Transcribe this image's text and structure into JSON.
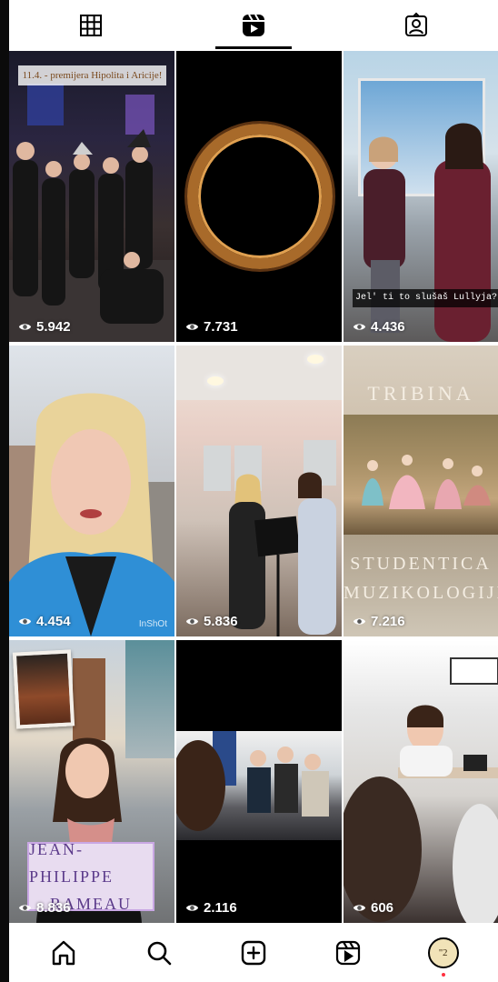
{
  "tabs": [
    {
      "id": "grid",
      "icon": "grid-icon",
      "active": false
    },
    {
      "id": "reels",
      "icon": "reels-icon",
      "active": true
    },
    {
      "id": "tagged",
      "icon": "tagged-icon",
      "active": false
    }
  ],
  "reels": [
    {
      "views": "5.942",
      "caption": "11.4. - premijera Hipolita i Aricije!"
    },
    {
      "views": "7.731"
    },
    {
      "views": "4.436",
      "caption": "Jel' ti to slušaš Lullyja?"
    },
    {
      "views": "4.454",
      "watermark": "InShOt"
    },
    {
      "views": "5.836"
    },
    {
      "views": "7.216",
      "title_top": "TRIBINA",
      "title_bottom_1": "STUDENTICA",
      "title_bottom_2": "MUZIKOLOGIJE"
    },
    {
      "views": "8.836",
      "card_line_1": "JEAN-PHILIPPE",
      "card_line_2": "RAMEAU"
    },
    {
      "views": "2.116"
    },
    {
      "views": "606"
    }
  ],
  "bottom_nav": {
    "avatar_text": "''2"
  },
  "colors": {
    "accent": "#000000",
    "notification_dot": "#ff3040"
  }
}
